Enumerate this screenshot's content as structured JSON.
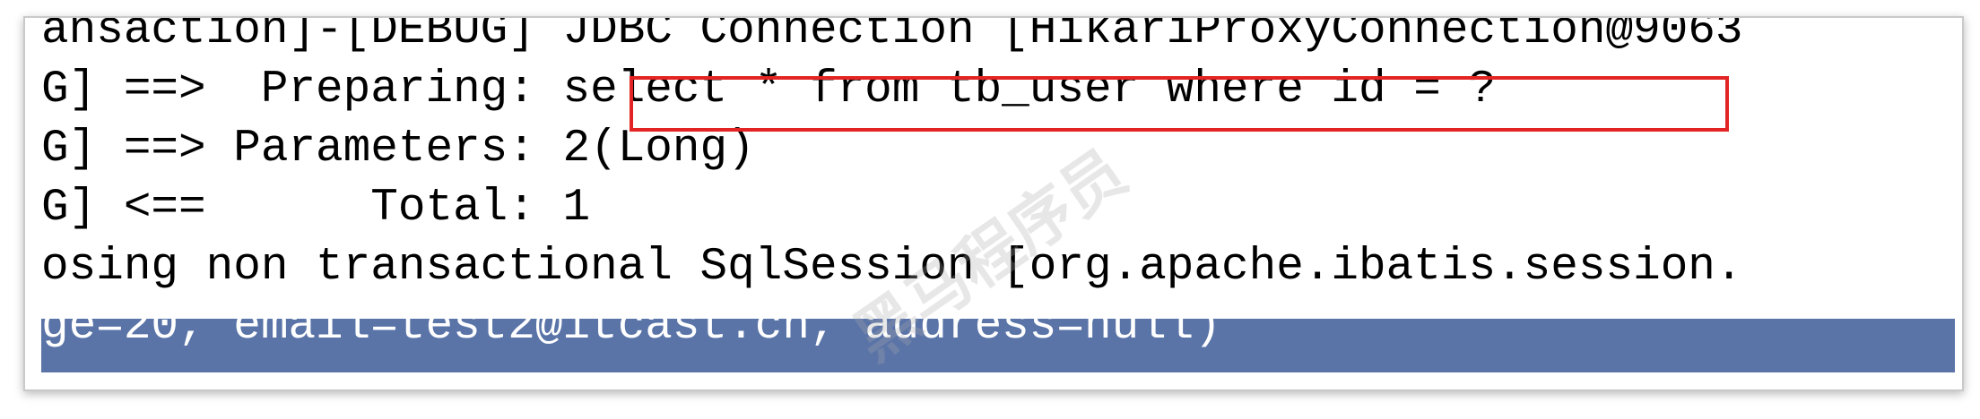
{
  "console": {
    "lines": [
      "ansaction]-[DEBUG] JDBC Connection [HikariProxyConnection@9063",
      "G] ==>  Preparing: select * from tb_user where id = ?",
      "G] ==> Parameters: 2(Long)",
      "G] <==      Total: 1",
      "osing non transactional SqlSession [org.apache.ibatis.session.",
      "ge=20, email=test2@itcast.cn, address=null)"
    ]
  },
  "highlight": {
    "color": "#e32424",
    "text": "select * from tb_user where id = ?"
  },
  "selection_color": "#5a74a8",
  "watermark": {
    "text": "黑马程序员"
  }
}
